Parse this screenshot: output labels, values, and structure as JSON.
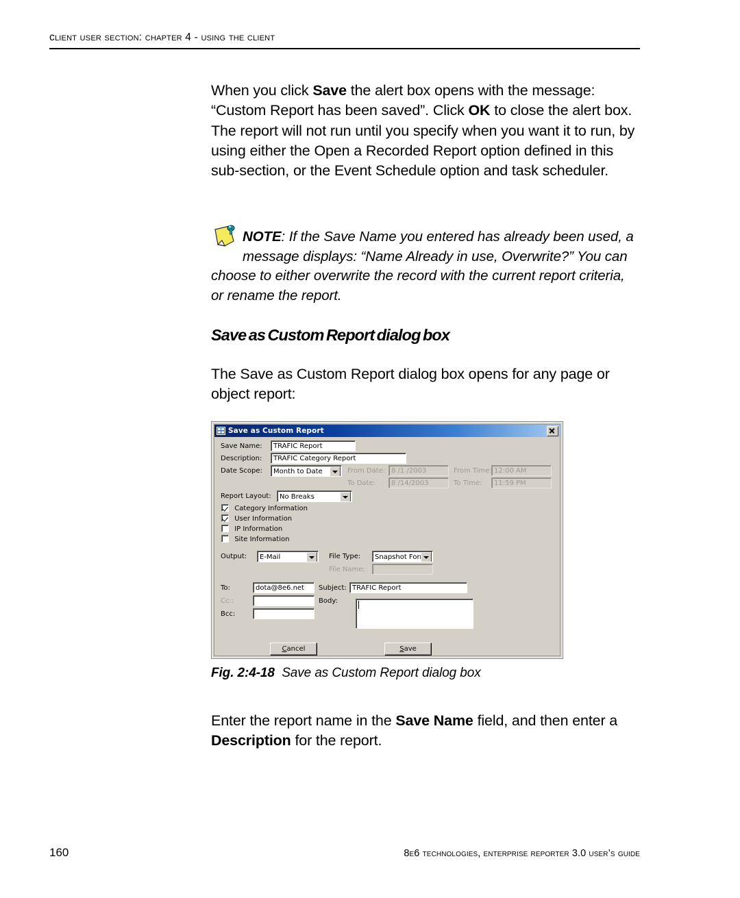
{
  "header": {
    "running_head": "Client User Section: Chapter 4 - Using the Client"
  },
  "paragraph_1": {
    "seg_1": "When you click ",
    "bold_1": "Save",
    "seg_2": " the alert box opens with the message: “Custom Report has been saved”. Click ",
    "bold_2": "OK",
    "seg_3": " to close the alert box. The report will not run until you specify when you want it to run, by using either the Open a Recorded Report option defined in this sub-section, or the Event Schedule option and task scheduler."
  },
  "note": {
    "icon": "sticky-note-icon",
    "label": "NOTE",
    "text": ": If the Save Name you entered has already been used, a message displays: “Name Already in use, Overwrite?” You can choose to either overwrite the record with the current report criteria, or rename the report."
  },
  "section_heading": "Save as Custom Report dialog box",
  "paragraph_2": "The Save as Custom Report dialog box opens for any page or object report:",
  "figure": {
    "caption_number": "Fig. 2:4-18",
    "caption_text": "Save as Custom Report dialog box"
  },
  "paragraph_3": {
    "seg_1": "Enter the report name in the ",
    "bold_1": "Save Name",
    "seg_2": " field, and then enter a ",
    "bold_2": "Description",
    "seg_3": " for the report."
  },
  "dialog": {
    "title": "Save as Custom Report",
    "title_icon": "window-report-icon",
    "close_icon": "close-icon",
    "fields": {
      "save_name_label": "Save Name:",
      "save_name_value": "TRAFIC Report",
      "description_label": "Description:",
      "description_value": "TRAFIC Category Report",
      "date_scope_label": "Date Scope:",
      "date_scope_value": "Month to Date",
      "from_date_label": "From Date:",
      "from_date_value": "8 /1 /2003",
      "from_time_label": "From Time:",
      "from_time_value": "12:00 AM",
      "to_date_label": "To Date:",
      "to_date_value": "8 /14/2003",
      "to_time_label": "To Time:",
      "to_time_value": "11:59 PM",
      "report_layout_label": "Report Layout:",
      "report_layout_value": "No Breaks",
      "output_label": "Output:",
      "output_value": "E-Mail",
      "file_type_label": "File Type:",
      "file_type_value": "Snapshot Forma",
      "file_name_label": "File Name:",
      "file_name_value": "",
      "to_label": "To:",
      "to_value": "dota@8e6.net",
      "cc_label": "Cc::",
      "cc_value": "",
      "bcc_label": "Bcc:",
      "bcc_value": "",
      "subject_label": "Subject:",
      "subject_value": "TRAFIC Report",
      "body_label": "Body:",
      "body_value": ""
    },
    "checkboxes": [
      {
        "label": "Category Information",
        "checked": true
      },
      {
        "label": "User Information",
        "checked": true
      },
      {
        "label": "IP Information",
        "checked": false
      },
      {
        "label": "Site Information",
        "checked": false
      }
    ],
    "buttons": {
      "cancel": "Cancel",
      "cancel_accel": "C",
      "save": "Save",
      "save_accel": "S"
    },
    "colors": {
      "face": "#d4d0c8",
      "title_start": "#0a246a",
      "title_end": "#a6caf0",
      "disabled_text": "#9b9b94"
    }
  },
  "footer": {
    "page_number": "160",
    "book_title": "8e6 Technologies, Enterprise Reporter 3.0 User’s Guide"
  }
}
